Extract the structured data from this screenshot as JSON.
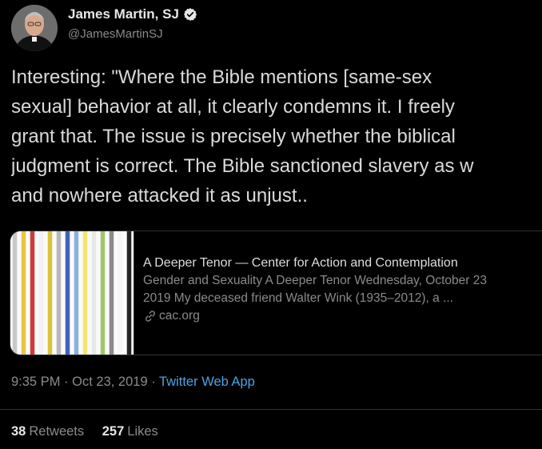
{
  "author": {
    "display_name": "James Martin, SJ",
    "handle": "@JamesMartinSJ",
    "verified_icon": "verified-badge-icon"
  },
  "tweet": {
    "lines": [
      "Interesting: \"Where the Bible mentions [same-sex",
      "sexual] behavior at all, it clearly condemns it. I freely",
      "grant that. The issue is precisely whether the biblical",
      "judgment is correct. The Bible sanctioned slavery as w",
      "and nowhere attacked it as unjust.."
    ]
  },
  "link_card": {
    "title": "A Deeper Tenor — Center for Action and Contemplation",
    "description_lines": [
      "Gender and Sexuality A Deeper Tenor Wednesday, October 23",
      "2019 My deceased friend Walter Wink (1935–2012), a ..."
    ],
    "domain": "cac.org",
    "domain_icon": "link-icon",
    "thumb_stripe_colors": [
      "#c8c8c8",
      "#e8c640",
      "#cf3a3a",
      "#f2f2f2",
      "#d9c337",
      "#b8b8b8",
      "#3f63b8",
      "#8ab1de",
      "#f4e46a",
      "#e7e7e7",
      "#a1c76a",
      "#8a8a8a",
      "#f5f5f5",
      "#222222"
    ]
  },
  "meta": {
    "time": "9:35 PM",
    "sep1": "·",
    "date": "Oct 23, 2019",
    "sep2": "·",
    "app": "Twitter Web App"
  },
  "stats": {
    "retweets_count": "38",
    "retweets_label": "Retweets",
    "likes_count": "257",
    "likes_label": "Likes"
  }
}
